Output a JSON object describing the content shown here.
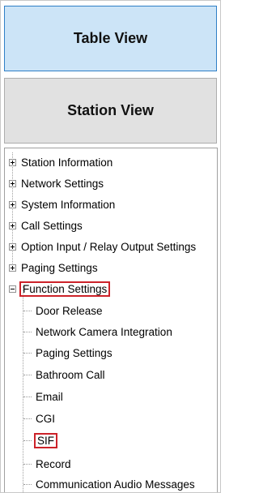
{
  "buttons": {
    "table_view": "Table View",
    "station_view": "Station View"
  },
  "tree": {
    "top_items": [
      "Station Information",
      "Network Settings",
      "System Information",
      "Call Settings",
      "Option Input / Relay Output Settings",
      "Paging Settings"
    ],
    "expanded_item": "Function Settings",
    "children": [
      "Door Release",
      "Network Camera Integration",
      "Paging Settings",
      "Bathroom Call",
      "Email",
      "CGI",
      "SIF",
      "Record",
      "Communication Audio Messages"
    ]
  },
  "colors": {
    "highlight": "#cc2229",
    "table_view_bg": "#cce4f7",
    "table_view_border": "#2f7fc6",
    "station_view_bg": "#e1e1e1"
  }
}
